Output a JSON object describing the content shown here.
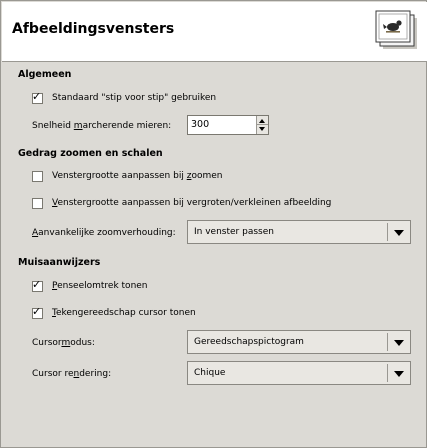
{
  "header": {
    "title": "Afbeeldingsvensters",
    "icon": "image-window-icon"
  },
  "general": {
    "title": "Algemeen",
    "dot_for_dot": {
      "label": "Standaard \"stip voor stip\" gebruiken",
      "checked": true
    },
    "marching_ants": {
      "label_pre": "Snelheid ",
      "label_ul": "m",
      "label_post": "archerende mieren:",
      "value": "300"
    }
  },
  "zoom": {
    "title": "Gedrag zoomen en schalen",
    "resize_on_zoom": {
      "label_pre": "Venstergrootte aanpassen bij ",
      "label_ul": "z",
      "label_post": "oomen",
      "checked": false
    },
    "resize_on_scale": {
      "label_pre": "",
      "label_ul": "V",
      "label_post": "enstergrootte aanpassen bij vergroten/verkleinen afbeelding",
      "checked": false
    },
    "initial_zoom": {
      "label_ul": "A",
      "label_post": "anvankelijke zoomverhouding:",
      "value": "In venster passen"
    }
  },
  "pointers": {
    "title": "Muisaanwijzers",
    "brush_outline": {
      "label_ul": "P",
      "label_post": "enseelomtrek tonen",
      "checked": true
    },
    "tool_cursor": {
      "label_ul": "T",
      "label_post": "ekengereedschap cursor tonen",
      "checked": true
    },
    "cursor_mode": {
      "label_pre": "Cursor",
      "label_ul": "m",
      "label_post": "odus:",
      "value": "Gereedschapspictogram"
    },
    "cursor_render": {
      "label_pre": "Cursor re",
      "label_ul": "n",
      "label_post": "dering:",
      "value": "Chique"
    }
  }
}
